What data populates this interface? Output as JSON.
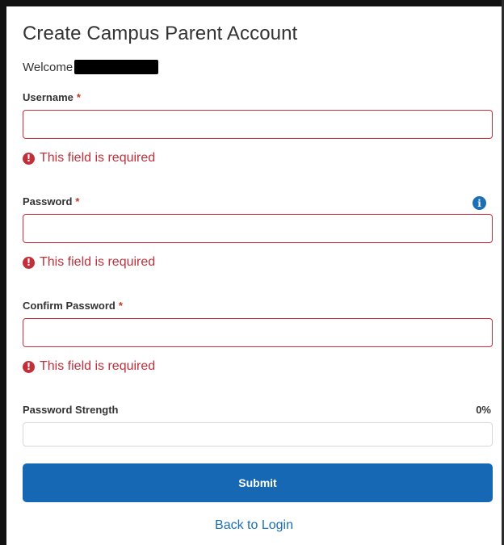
{
  "page": {
    "title": "Create Campus Parent Account",
    "welcome_text": "Welcome"
  },
  "fields": {
    "username": {
      "label": "Username",
      "required_mark": "*",
      "value": "",
      "error": "This field is required"
    },
    "password": {
      "label": "Password",
      "required_mark": "*",
      "value": "",
      "error": "This field is required",
      "info_icon": "info-icon"
    },
    "confirm_password": {
      "label": "Confirm Password",
      "required_mark": "*",
      "value": "",
      "error": "This field is required"
    }
  },
  "strength": {
    "label": "Password Strength",
    "value_text": "0%",
    "value": 0
  },
  "actions": {
    "submit_label": "Submit",
    "back_label": "Back to Login"
  },
  "icons": {
    "error": "!",
    "info": "i"
  },
  "colors": {
    "primary": "#1668b4",
    "error": "#c0303a"
  }
}
